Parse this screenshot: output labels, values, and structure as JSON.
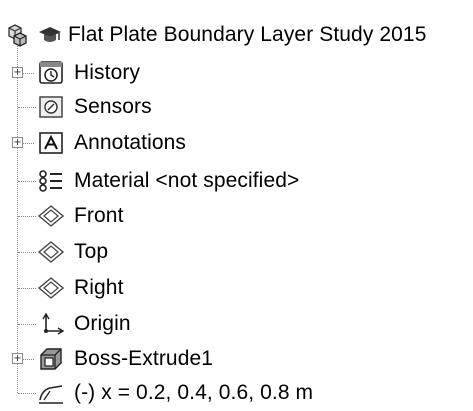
{
  "tree": {
    "root": {
      "label": "Flat Plate Boundary Layer Study 2015",
      "icon": "part-icon"
    },
    "items": [
      {
        "label": "History",
        "icon": "history-icon",
        "expandable": true
      },
      {
        "label": "Sensors",
        "icon": "sensors-icon",
        "expandable": false
      },
      {
        "label": "Annotations",
        "icon": "annotations-icon",
        "expandable": true
      },
      {
        "label": "Material <not specified>",
        "icon": "material-icon",
        "expandable": false
      },
      {
        "label": "Front",
        "icon": "plane-icon",
        "expandable": false
      },
      {
        "label": "Top",
        "icon": "plane-icon",
        "expandable": false
      },
      {
        "label": "Right",
        "icon": "plane-icon",
        "expandable": false
      },
      {
        "label": "Origin",
        "icon": "origin-icon",
        "expandable": false
      },
      {
        "label": "Boss-Extrude1",
        "icon": "extrude-icon",
        "expandable": true
      },
      {
        "label": "(-) x = 0.2, 0.4, 0.6, 0.8 m",
        "icon": "sketch-icon",
        "expandable": false
      }
    ],
    "expander_symbol": "+"
  }
}
